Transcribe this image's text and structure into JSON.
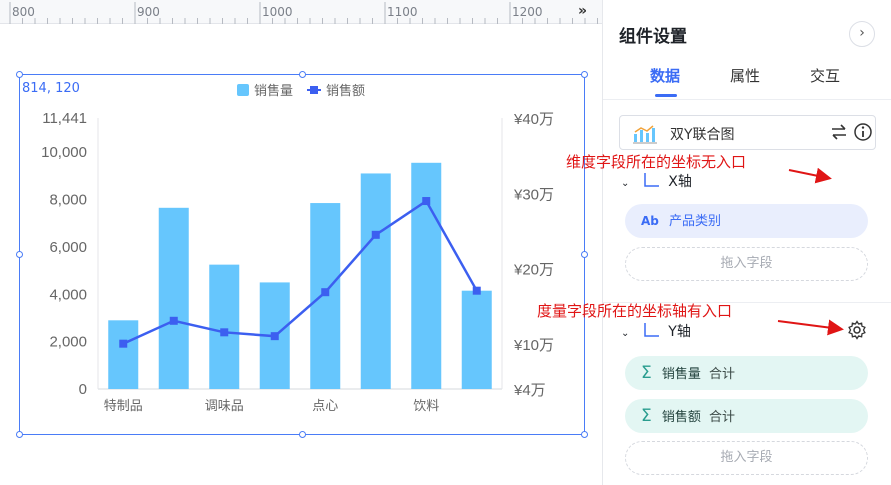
{
  "ruler": {
    "labels": [
      "800",
      "900",
      "1000",
      "1100",
      "1200"
    ],
    "collapse_icon": "double-chevron-right"
  },
  "canvas": {
    "coord_text": "814, 120"
  },
  "chart_data": {
    "type": "bar+line",
    "categories": [
      "特制品",
      "",
      "调味品",
      "",
      "点心",
      "",
      "饮料",
      ""
    ],
    "x_tick_labels": [
      "特制品",
      "调味品",
      "点心",
      "饮料"
    ],
    "series": [
      {
        "name": "销售量",
        "type": "bar",
        "axis": "left",
        "color": "#66c6fd",
        "values": [
          2900,
          7650,
          5250,
          4500,
          7850,
          9100,
          9550,
          4150
        ]
      },
      {
        "name": "销售额",
        "type": "line",
        "axis": "right",
        "color": "#3c5ff0",
        "values": [
          100200,
          130600,
          115300,
          110200,
          168600,
          244800,
          289700,
          170600
        ]
      }
    ],
    "left_axis": {
      "ticks": [
        "0",
        "2,000",
        "4,000",
        "6,000",
        "8,000",
        "10,000",
        "11,441"
      ],
      "tick_values": [
        0,
        2000,
        4000,
        6000,
        8000,
        10000,
        11441
      ],
      "ylim": [
        0,
        11441
      ]
    },
    "right_axis": {
      "ticks": [
        "¥4万",
        "¥10万",
        "¥20万",
        "¥30万",
        "¥40万"
      ],
      "tick_values": [
        40000,
        100000,
        200000,
        300000,
        400000
      ],
      "ylim": [
        40000,
        400000
      ]
    },
    "legend_position": "top-center"
  },
  "panel": {
    "title": "组件设置",
    "collapse_icon": "chevron-right",
    "tabs": [
      {
        "label": "数据",
        "active": true
      },
      {
        "label": "属性",
        "active": false
      },
      {
        "label": "交互",
        "active": false
      }
    ],
    "chart_type": {
      "label": "双Y联合图",
      "icon": "dual-axis-chart-icon",
      "actions": [
        "swap-icon",
        "info-icon"
      ]
    },
    "x_axis": {
      "label": "X轴",
      "field": {
        "type_badge": "Ab",
        "name": "产品类别"
      },
      "drop_placeholder": "拖入字段"
    },
    "y_axis": {
      "label": "Y轴",
      "settings_icon": "gear-icon",
      "fields": [
        {
          "name": "销售量",
          "agg": "合计"
        },
        {
          "name": "销售额",
          "agg": "合计"
        }
      ],
      "drop_placeholder": "拖入字段"
    }
  },
  "annotations": {
    "x_note": "维度字段所在的坐标无入口",
    "y_note": "度量字段所在的坐标轴有入口",
    "color": "#e01515"
  },
  "colors": {
    "accent": "#3b6cf5",
    "bar": "#66c6fd",
    "line": "#3c5ff0",
    "annotation": "#e01515"
  }
}
